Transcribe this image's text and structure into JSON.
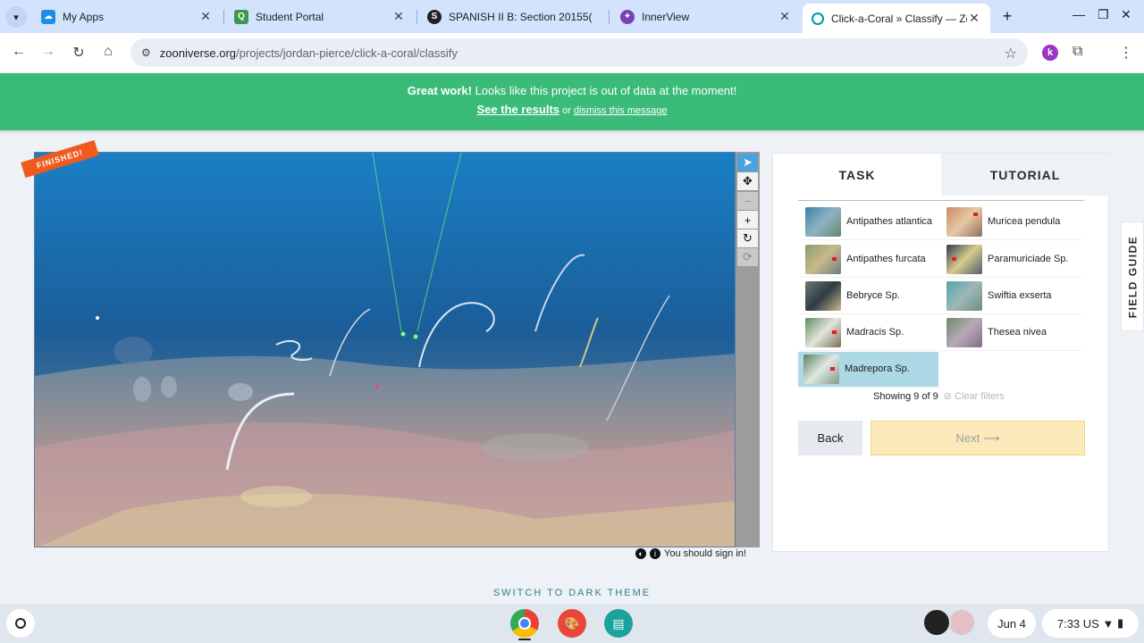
{
  "tabs": [
    {
      "title": "My Apps",
      "icon": "cloud-icon",
      "color": "#1f8de0"
    },
    {
      "title": "Student Portal",
      "icon": "q-logo-icon",
      "color": "#3a9a4a"
    },
    {
      "title": "SPANISH II B: Section 20155(",
      "icon": "s-logo-icon",
      "color": "#202124"
    },
    {
      "title": "InnerView",
      "icon": "innerview-logo-icon",
      "color": "#7a3fb3"
    },
    {
      "title": "Click-a-Coral » Classify — Zoo",
      "icon": "zooniverse-icon",
      "color": "#00979d"
    }
  ],
  "address_bar": {
    "domain": "zooniverse.org",
    "path": "/projects/jordan-pierce/click-a-coral/classify"
  },
  "banner": {
    "great": "Great work!",
    "message": " Looks like this project is out of data at the moment!",
    "results": "See the results",
    "or": " or ",
    "dismiss": "dismiss this message",
    "color": "#3bbb78"
  },
  "viewer": {
    "ribbon": "FINISHED!",
    "ribbon_color": "#f05a1e"
  },
  "sign_in": "You should sign in!",
  "panel": {
    "tab_task": "TASK",
    "tab_tutorial": "TUTORIAL",
    "choices": [
      {
        "label": "Antipathes atlantica",
        "selected": false
      },
      {
        "label": "Muricea pendula",
        "selected": false
      },
      {
        "label": "Antipathes furcata",
        "selected": false
      },
      {
        "label": "Paramuriciade Sp.",
        "selected": false
      },
      {
        "label": "Bebryce Sp.",
        "selected": false
      },
      {
        "label": "Swiftia exserta",
        "selected": false
      },
      {
        "label": "Madracis Sp.",
        "selected": false
      },
      {
        "label": "Thesea nivea",
        "selected": false
      },
      {
        "label": "Madrepora Sp.",
        "selected": true
      }
    ],
    "showing": "Showing 9 of 9",
    "clear_filters": "Clear filters",
    "back": "Back",
    "next": "Next"
  },
  "field_guide": "FIELD GUIDE",
  "dark_theme": "SWITCH TO DARK THEME",
  "shelf": {
    "date": "Jun 4",
    "time": "7:33",
    "locale": "US"
  }
}
